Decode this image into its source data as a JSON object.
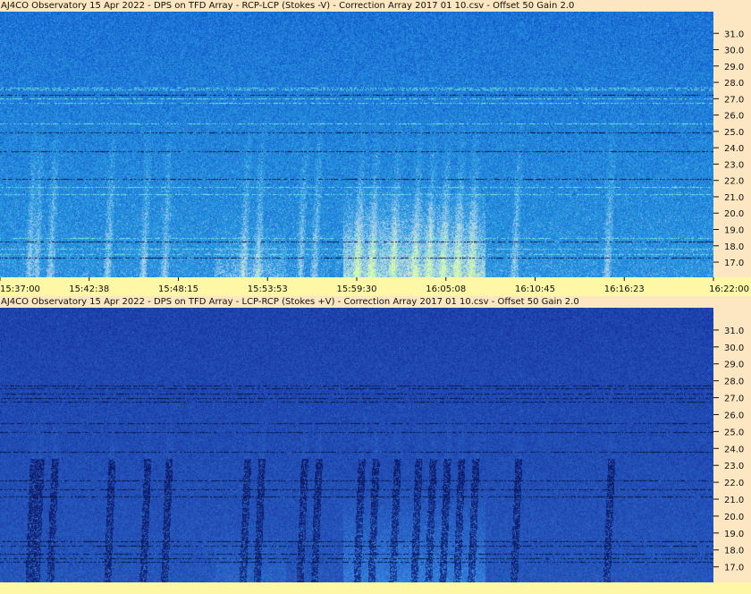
{
  "panels": [
    {
      "title": "AJ4CO Observatory 15 Apr 2022  -  DPS on TFD Array  -  RCP-LCP (Stokes -V)  -  Correction Array 2017 01 10.csv  -  Offset 50  Gain 2.0",
      "polarity": "RCP-LCP (Stokes -V)",
      "brightness": "bright"
    },
    {
      "title": "AJ4CO Observatory 15 Apr 2022  -  DPS on TFD Array  -  LCP-RCP (Stokes +V)  -  Correction Array 2017 01 10.csv  -  Offset 50  Gain 2.0",
      "polarity": "LCP-RCP (Stokes +V)",
      "brightness": "dark"
    }
  ],
  "time_ticks": [
    "15:37:00",
    "15:42:38",
    "15:48:15",
    "15:53:53",
    "15:59:30",
    "16:05:08",
    "16:10:45",
    "16:16:23",
    "16:22:00"
  ],
  "freq_ticks": [
    "17.0",
    "18.0",
    "19.0",
    "20.0",
    "21.0",
    "22.0",
    "23.0",
    "24.0",
    "25.0",
    "26.0",
    "27.0",
    "28.0",
    "29.0",
    "30.0",
    "31.0"
  ],
  "colors": {
    "background": "#fde7c2",
    "time_axis_bg": "#fdf7a6",
    "spectro_bright_base": "#2a6ee0",
    "spectro_dark_base": "#1a3fc0",
    "burst_green": "#b8f040",
    "interference_cyan": "#40d0f0"
  },
  "chart_data": [
    {
      "type": "heatmap",
      "title": "AJ4CO Observatory 15 Apr 2022  -  DPS on TFD Array  -  RCP-LCP (Stokes -V)  -  Correction Array 2017 01 10.csv  -  Offset 50  Gain 2.0",
      "x_ticks": [
        "15:37:00",
        "15:42:38",
        "15:48:15",
        "15:53:53",
        "15:59:30",
        "16:05:08",
        "16:10:45",
        "16:16:23",
        "16:22:00"
      ],
      "y_ticks": [
        17.0,
        18.0,
        19.0,
        20.0,
        21.0,
        22.0,
        23.0,
        24.0,
        25.0,
        26.0,
        27.0,
        28.0,
        29.0,
        30.0,
        31.0
      ],
      "xlim": [
        "15:37:00",
        "16:22:00"
      ],
      "ylim": [
        16.4,
        32.0
      ]
    },
    {
      "type": "heatmap",
      "title": "AJ4CO Observatory 15 Apr 2022  -  DPS on TFD Array  -  LCP-RCP (Stokes +V)  -  Correction Array 2017 01 10.csv  -  Offset 50  Gain 2.0",
      "x_ticks": [],
      "y_ticks": [
        17.0,
        18.0,
        19.0,
        20.0,
        21.0,
        22.0,
        23.0,
        24.0,
        25.0,
        26.0,
        27.0,
        28.0,
        29.0,
        30.0,
        31.0
      ],
      "xlim": [
        "15:37:00",
        "16:22:00"
      ],
      "ylim": [
        16.4,
        32.0
      ]
    }
  ]
}
